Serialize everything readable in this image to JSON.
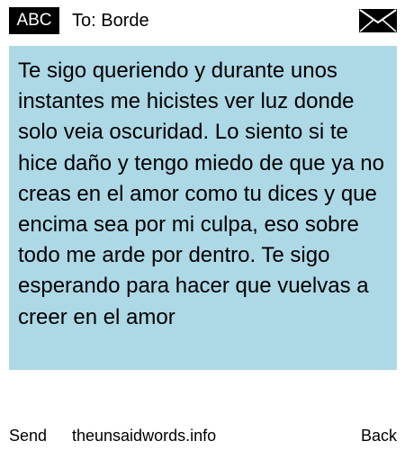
{
  "header": {
    "badge_label": "ABC",
    "recipient_text": "To: Borde",
    "envelope_icon": "envelope-icon"
  },
  "message": {
    "body": "Te sigo queriendo y durante unos instantes me hicistes ver luz donde solo veia oscuridad. Lo siento si te hice daño y tengo miedo de que ya no creas en el amor como tu dices y que encima sea por mi culpa, eso sobre todo me arde por dentro. Te sigo esperando para hacer que vuelvas a creer en el amor",
    "background_color": "#add8e6"
  },
  "footer": {
    "send_label": "Send",
    "site_label": "theunsaidwords.info",
    "back_label": "Back"
  }
}
